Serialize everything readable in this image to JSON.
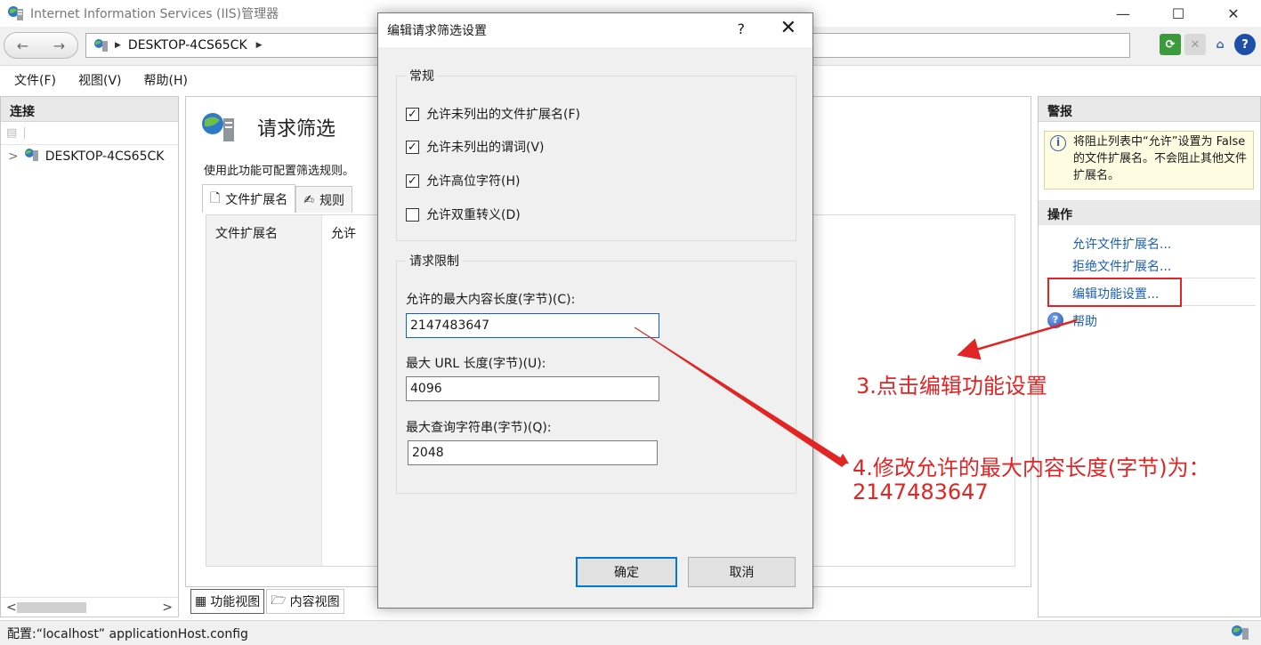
{
  "window": {
    "title": "Internet Information Services (IIS)管理器",
    "controls": {
      "minimize": "—",
      "maximize": "☐",
      "close": "✕"
    }
  },
  "address": {
    "back": "←",
    "forward": "→",
    "crumb": "DESKTOP-4CS65CK",
    "sep": "▶",
    "crumb_sep": "▶"
  },
  "menu": {
    "items": [
      "文件(F)",
      "视图(V)",
      "帮助(H)"
    ]
  },
  "connections": {
    "header": "连接",
    "tree_node": "DESKTOP-4CS65CK",
    "expander": ">",
    "scroll_left": "<",
    "scroll_right": ">"
  },
  "center": {
    "title": "请求筛选",
    "description": "使用此功能可配置筛选规则。",
    "tabs": [
      "文件扩展名",
      "规则"
    ],
    "columns": [
      "文件扩展名",
      "允许"
    ],
    "bottom_tabs": [
      "功能视图",
      "内容视图"
    ]
  },
  "actions": {
    "alerts_header": "警报",
    "alert_text": "将阻止列表中“允许”设置为 False 的文件扩展名。不会阻止其他文件扩展名。",
    "ops_header": "操作",
    "links": [
      "允许文件扩展名...",
      "拒绝文件扩展名...",
      "编辑功能设置...",
      "帮助"
    ]
  },
  "status": {
    "text": "配置:“localhost” applicationHost.config"
  },
  "dialog": {
    "title": "编辑请求筛选设置",
    "help": "?",
    "close": "✕",
    "general_group": "常规",
    "checkboxes": [
      {
        "label": "允许未列出的文件扩展名(F)",
        "checked": true
      },
      {
        "label": "允许未列出的谓词(V)",
        "checked": true
      },
      {
        "label": "允许高位字符(H)",
        "checked": true
      },
      {
        "label": "允许双重转义(D)",
        "checked": false
      }
    ],
    "limits_group": "请求限制",
    "fields": [
      {
        "label": "允许的最大内容长度(字节)(C):",
        "value": "2147483647"
      },
      {
        "label": "最大 URL 长度(字节)(U):",
        "value": "4096"
      },
      {
        "label": "最大查询字符串(字节)(Q):",
        "value": "2048"
      }
    ],
    "ok": "确定",
    "cancel": "取消"
  },
  "annotations": {
    "step3": "3.点击编辑功能设置",
    "step4_line1": "4.修改允许的最大内容长度(字节)为：",
    "step4_line2": "2147483647",
    "color": "#e12424"
  },
  "colors": {
    "accent": "#0078d7",
    "link": "#1a5fb4",
    "alert_bg": "#fffde1"
  }
}
